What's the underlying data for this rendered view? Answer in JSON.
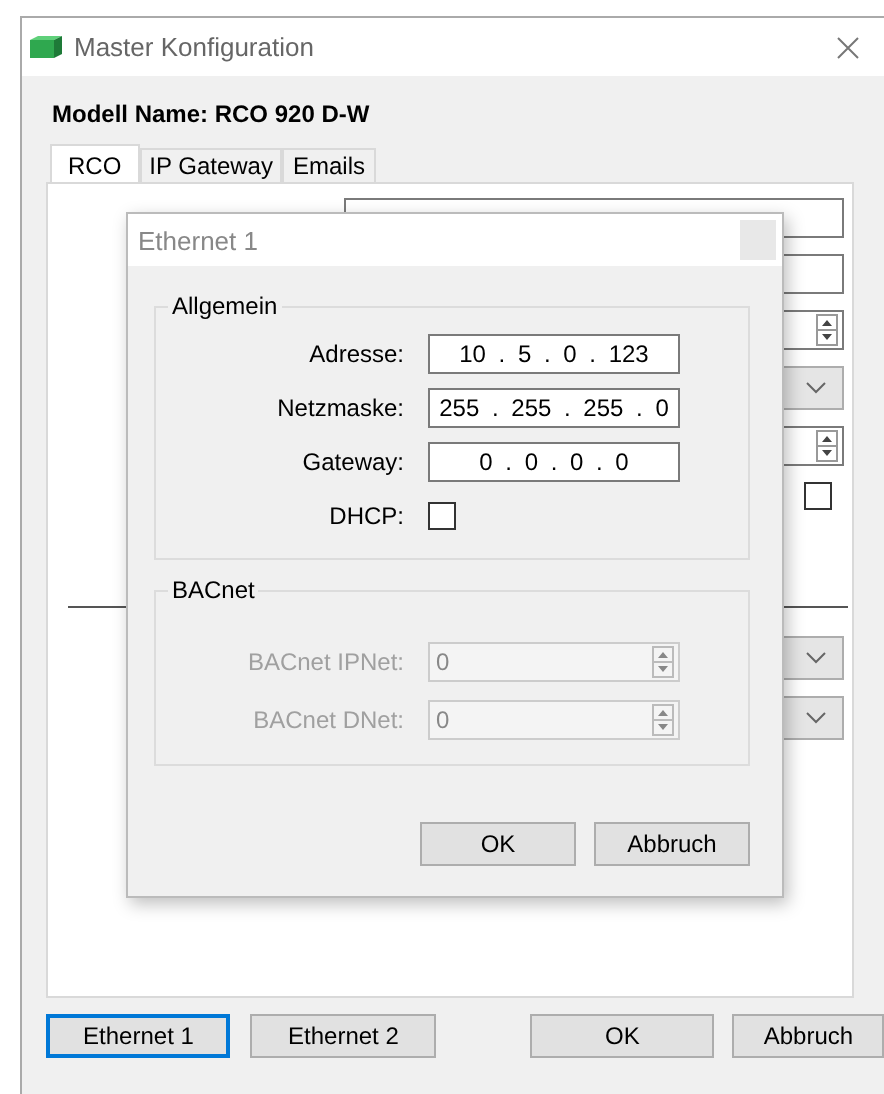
{
  "window": {
    "title": "Master Konfiguration"
  },
  "model_name": "Modell Name: RCO 920 D-W",
  "tabs": [
    {
      "label": "RCO",
      "selected": true
    },
    {
      "label": "IP Gateway",
      "selected": false
    },
    {
      "label": "Emails",
      "selected": false
    }
  ],
  "background_form": {
    "fields": [
      {
        "kind": "text"
      },
      {
        "kind": "text"
      },
      {
        "kind": "spinner"
      },
      {
        "kind": "dropdown"
      },
      {
        "kind": "spinner"
      },
      {
        "kind": "checkbox",
        "checked": false
      },
      {
        "kind": "rule"
      },
      {
        "kind": "dropdown"
      },
      {
        "kind": "dropdown"
      }
    ]
  },
  "dialog": {
    "title": "Ethernet 1",
    "groups": [
      {
        "title": "Allgemein",
        "disabled": false,
        "rows": [
          {
            "kind": "ip",
            "label": "Adresse:",
            "value": "10 . 5 . 0 . 123"
          },
          {
            "kind": "ip",
            "label": "Netzmaske:",
            "value": "255 . 255 . 255 . 0"
          },
          {
            "kind": "ip",
            "label": "Gateway:",
            "value": "0 . 0 . 0 . 0"
          },
          {
            "kind": "checkbox",
            "label": "DHCP:",
            "checked": false
          }
        ]
      },
      {
        "title": "BACnet",
        "disabled": true,
        "rows": [
          {
            "kind": "spinner",
            "label": "BACnet IPNet:",
            "value": "0"
          },
          {
            "kind": "spinner",
            "label": "BACnet DNet:",
            "value": "0"
          }
        ]
      }
    ],
    "buttons": [
      "OK",
      "Abbruch"
    ]
  },
  "footer_buttons": [
    {
      "label": "Ethernet 1",
      "focused": true
    },
    {
      "label": "Ethernet 2",
      "focused": false
    },
    {
      "label": "OK",
      "focused": false
    },
    {
      "label": "Abbruch",
      "focused": false
    }
  ]
}
